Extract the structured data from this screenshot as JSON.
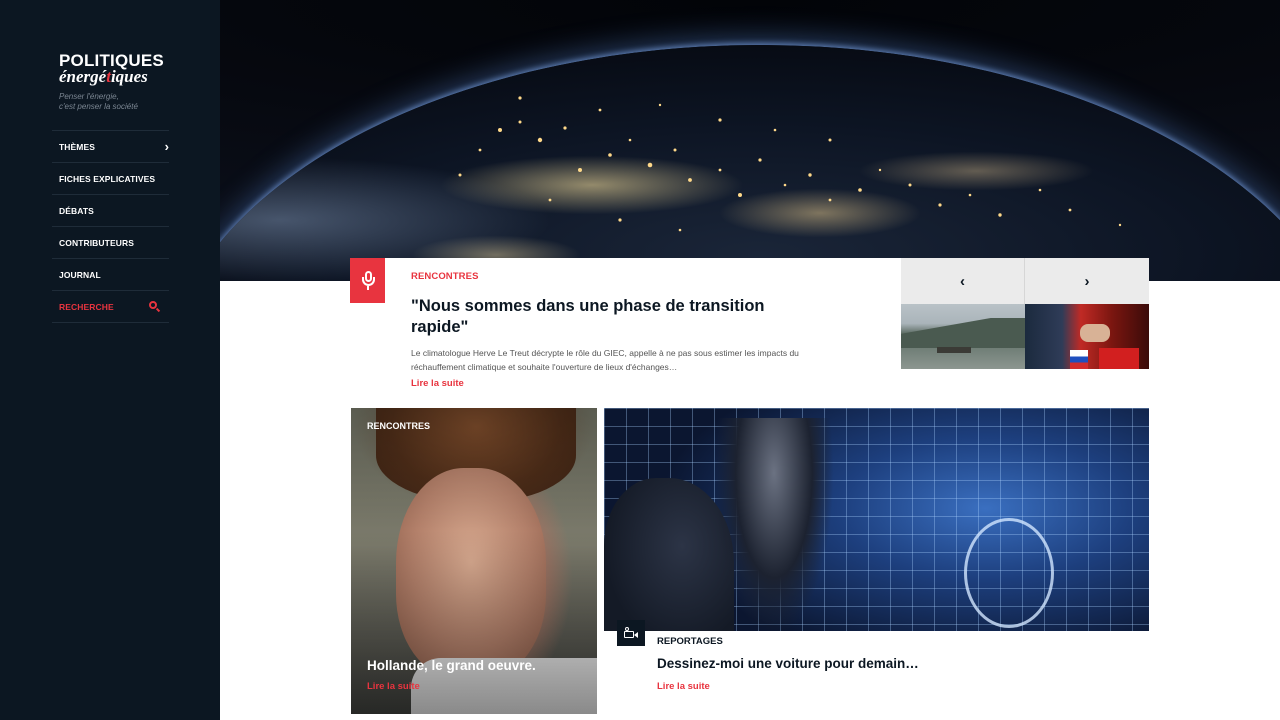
{
  "brand": {
    "logo_line1": "POLITIQUES",
    "logo_line2_a": "énergé",
    "logo_line2_b": "t",
    "logo_line2_c": "iques",
    "tagline_line1": "Penser l'énergie,",
    "tagline_line2": "c'est penser la société",
    "accent_color": "#e8343f",
    "sidebar_color": "#0c1722"
  },
  "nav": {
    "items": [
      {
        "label": "THÈMES",
        "icon": "chevron-right-icon"
      },
      {
        "label": "FICHES EXPLICATIVES"
      },
      {
        "label": "DÉBATS"
      },
      {
        "label": "CONTRIBUTEURS"
      },
      {
        "label": "JOURNAL"
      },
      {
        "label": "RECHERCHE",
        "icon": "search-icon"
      }
    ]
  },
  "hero": {
    "image": "earth-at-night-photo"
  },
  "featured": {
    "icon": "microphone-icon",
    "category": "RENCONTRES",
    "title": "\"Nous sommes dans une phase de transition rapide\"",
    "excerpt": "Le climatologue Herve Le Treut décrypte le rôle du GIEC, appelle à ne pas sous estimer les impacts du réchauffement climatique et souhaite l'ouverture de lieux d'échanges…",
    "link": "Lire la suite"
  },
  "carousel": {
    "prev_icon": "chevron-left-icon",
    "next_icon": "chevron-right-icon",
    "prev_label": "‹",
    "next_label": "›",
    "thumbnails": [
      "lake-mountain-photo",
      "handshake-flags-photo"
    ]
  },
  "cards": [
    {
      "category": "RENCONTRES",
      "title": "Hollande, le grand oeuvre.",
      "link": "Lire la suite",
      "image": "woman-portrait-photo"
    },
    {
      "category": "REPORTAGES",
      "title": "Dessinez-moi une voiture pour demain…",
      "link": "Lire la suite",
      "icon": "video-camera-icon",
      "image": "car-wireframe-photo"
    }
  ]
}
